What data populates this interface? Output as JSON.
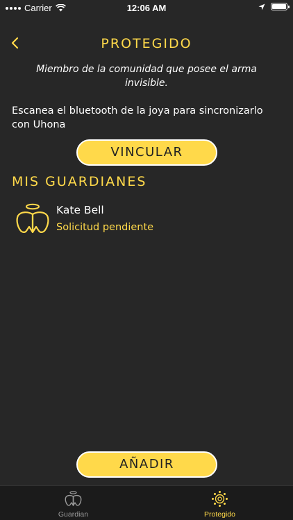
{
  "status_bar": {
    "carrier": "Carrier",
    "time": "12:06 AM",
    "battery_level": 1.0
  },
  "header": {
    "title": "PROTEGIDO"
  },
  "subtitle": "Miembro de la comunidad que posee el arma invisible.",
  "instructions": "Escanea el bluetooth de la joya para sincronizarlo con Uhona",
  "link_button": {
    "label": "VINCULAR"
  },
  "section": {
    "title": "MIS GUARDIANES"
  },
  "guardians": [
    {
      "name": "Kate Bell",
      "status": "Solicitud pendiente"
    }
  ],
  "add_button": {
    "label": "AÑADIR"
  },
  "tabs": [
    {
      "label": "Guardian",
      "active": false,
      "icon": "angel-icon"
    },
    {
      "label": "Protegido",
      "active": true,
      "icon": "sun-gear-icon"
    }
  ],
  "colors": {
    "accent": "#ffd94a",
    "background": "#272727",
    "tab_bar": "#1b1b1b",
    "inactive": "#9a9a9a"
  }
}
